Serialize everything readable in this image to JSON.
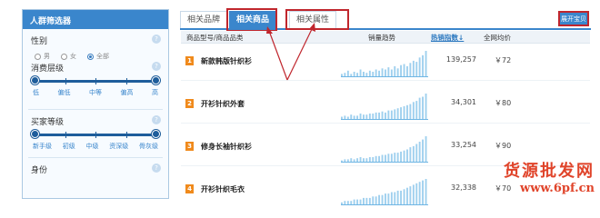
{
  "sidebar": {
    "title": "人群筛选器",
    "gender": {
      "title": "性别",
      "options": [
        "男",
        "女",
        "全部"
      ],
      "selected": "全部"
    },
    "consumption": {
      "title": "消费层级",
      "labels": [
        "低",
        "偏低",
        "中等",
        "偏高",
        "高"
      ]
    },
    "buyer_level": {
      "title": "买家等级",
      "labels": [
        "新手级",
        "初级",
        "中级",
        "资深级",
        "骨灰级"
      ]
    },
    "identity": {
      "title": "身份"
    },
    "help_glyph": "?"
  },
  "tabs": [
    {
      "label": "相关品牌",
      "active": false
    },
    {
      "label": "相关商品",
      "active": true
    },
    {
      "label": "相关属性",
      "active": false
    }
  ],
  "expand_label": "展开宝贝",
  "table": {
    "headers": {
      "name": "商品型号/商品品类",
      "trend": "销量趋势",
      "index": "热销指数",
      "sort_arrow": "↓",
      "price": "全网均价"
    },
    "rows": [
      {
        "rank": "1",
        "name": "新款韩版针织衫",
        "index": "139,257",
        "price": "￥72",
        "trend": [
          3,
          4,
          6,
          3,
          5,
          4,
          7,
          5,
          4,
          6,
          5,
          7,
          6,
          8,
          7,
          9,
          7,
          10,
          8,
          11,
          12,
          10,
          13,
          15,
          14,
          18,
          20,
          24
        ]
      },
      {
        "rank": "2",
        "name": "开衫针织外套",
        "index": "34,301",
        "price": "￥80",
        "trend": [
          3,
          4,
          3,
          5,
          4,
          4,
          6,
          5,
          5,
          6,
          6,
          7,
          7,
          8,
          7,
          9,
          9,
          10,
          11,
          12,
          13,
          14,
          15,
          17,
          18,
          21,
          22,
          25
        ]
      },
      {
        "rank": "3",
        "name": "修身长袖针织衫",
        "index": "33,254",
        "price": "￥90",
        "trend": [
          2,
          3,
          3,
          4,
          3,
          4,
          5,
          4,
          4,
          5,
          5,
          6,
          6,
          7,
          7,
          8,
          8,
          9,
          9,
          10,
          11,
          12,
          14,
          15,
          17,
          19,
          21,
          24
        ]
      },
      {
        "rank": "4",
        "name": "开衫针织毛衣",
        "index": "32,338",
        "price": "￥70",
        "trend": [
          2,
          3,
          3,
          3,
          4,
          4,
          4,
          5,
          5,
          5,
          6,
          6,
          7,
          7,
          8,
          8,
          9,
          9,
          10,
          10,
          11,
          12,
          13,
          14,
          15,
          16,
          17,
          18
        ]
      }
    ]
  },
  "watermark": {
    "line1": "货源批发网",
    "line2": "www.6pf.cn"
  },
  "colors": {
    "accent": "#3a86cc",
    "annotation_red": "#c0262d",
    "rank_orange": "#f08a1c",
    "trend_fill": "#9fd0ee"
  }
}
